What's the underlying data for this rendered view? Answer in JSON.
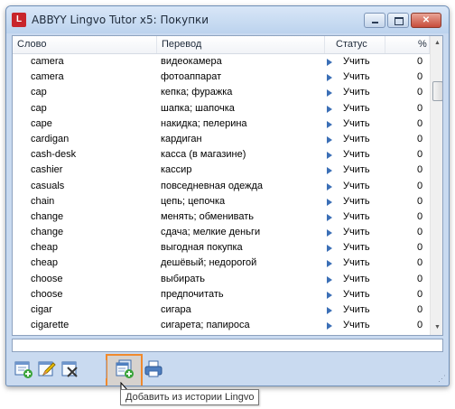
{
  "window": {
    "title": "ABBYY Lingvo Tutor x5: Покупки",
    "icon_letter": "L",
    "minimize_glyph": "",
    "maximize_glyph": "",
    "close_glyph": "✕"
  },
  "table": {
    "headers": {
      "word": "Слово",
      "translation": "Перевод",
      "status": "Статус",
      "percent": "%"
    },
    "rows": [
      {
        "word": "camera",
        "translation": "видеокамера",
        "status": "Учить",
        "percent": "0"
      },
      {
        "word": "camera",
        "translation": "фотоаппарат",
        "status": "Учить",
        "percent": "0"
      },
      {
        "word": "cap",
        "translation": "кепка; фуражка",
        "status": "Учить",
        "percent": "0"
      },
      {
        "word": "cap",
        "translation": "шапка; шапочка",
        "status": "Учить",
        "percent": "0"
      },
      {
        "word": "cape",
        "translation": "накидка; пелерина",
        "status": "Учить",
        "percent": "0"
      },
      {
        "word": "cardigan",
        "translation": "кардиган",
        "status": "Учить",
        "percent": "0"
      },
      {
        "word": "cash-desk",
        "translation": "касса (в магазине)",
        "status": "Учить",
        "percent": "0"
      },
      {
        "word": "cashier",
        "translation": "кассир",
        "status": "Учить",
        "percent": "0"
      },
      {
        "word": "casuals",
        "translation": "повседневная одежда",
        "status": "Учить",
        "percent": "0"
      },
      {
        "word": "chain",
        "translation": "цепь; цепочка",
        "status": "Учить",
        "percent": "0"
      },
      {
        "word": "change",
        "translation": "менять; обменивать",
        "status": "Учить",
        "percent": "0"
      },
      {
        "word": "change",
        "translation": "сдача; мелкие деньги",
        "status": "Учить",
        "percent": "0"
      },
      {
        "word": "cheap",
        "translation": "выгодная покупка",
        "status": "Учить",
        "percent": "0"
      },
      {
        "word": "cheap",
        "translation": "дешёвый; недорогой",
        "status": "Учить",
        "percent": "0"
      },
      {
        "word": "choose",
        "translation": "выбирать",
        "status": "Учить",
        "percent": "0"
      },
      {
        "word": "choose",
        "translation": "предпочитать",
        "status": "Учить",
        "percent": "0"
      },
      {
        "word": "cigar",
        "translation": "сигара",
        "status": "Учить",
        "percent": "0"
      },
      {
        "word": "cigarette",
        "translation": "сигарета; папироса",
        "status": "Учить",
        "percent": "0"
      }
    ]
  },
  "scrollbar": {
    "up_glyph": "▲",
    "down_glyph": "▼"
  },
  "toolbar": {
    "buttons": [
      "add-card-icon",
      "edit-card-icon",
      "delete-card-icon",
      "add-from-history-icon",
      "print-icon"
    ],
    "grip_glyph": "⋰"
  },
  "tooltip": {
    "text": "Добавить из истории Lingvo"
  },
  "colors": {
    "accent": "#3b6fb6",
    "highlight": "#f0892c",
    "window_frame": "#c9daf0"
  }
}
